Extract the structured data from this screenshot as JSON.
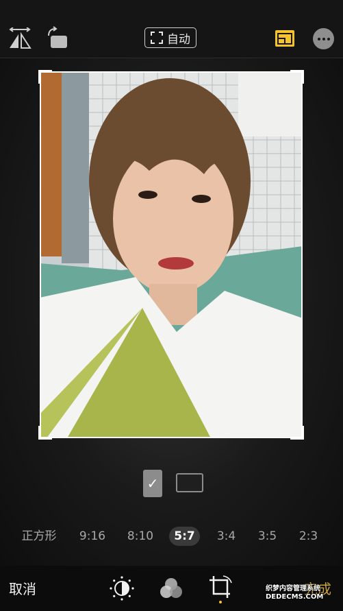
{
  "toolbar": {
    "auto_label": "自动",
    "accent": "#f5c32c"
  },
  "icons": {
    "flip": "flip-horizontal-icon",
    "rotate": "rotate-icon",
    "auto_crop": "auto-crop-icon",
    "aspect": "aspect-ratio-icon",
    "more": "more-icon",
    "adjust": "adjust-dial-icon",
    "filters": "filters-icon",
    "crop": "crop-icon"
  },
  "ratios": [
    {
      "label": "正方形",
      "active": false
    },
    {
      "label": "9:16",
      "active": false
    },
    {
      "label": "8:10",
      "active": false
    },
    {
      "label": "5:7",
      "active": true
    },
    {
      "label": "3:4",
      "active": false
    },
    {
      "label": "3:5",
      "active": false
    },
    {
      "label": "2:3",
      "active": false
    }
  ],
  "orientation": {
    "portrait_mark": "✓"
  },
  "bottom": {
    "cancel_label": "取消",
    "done_label": "完成"
  },
  "watermark": {
    "line1": "织梦内容管理系统",
    "line2": "DEDECMS.COM"
  }
}
